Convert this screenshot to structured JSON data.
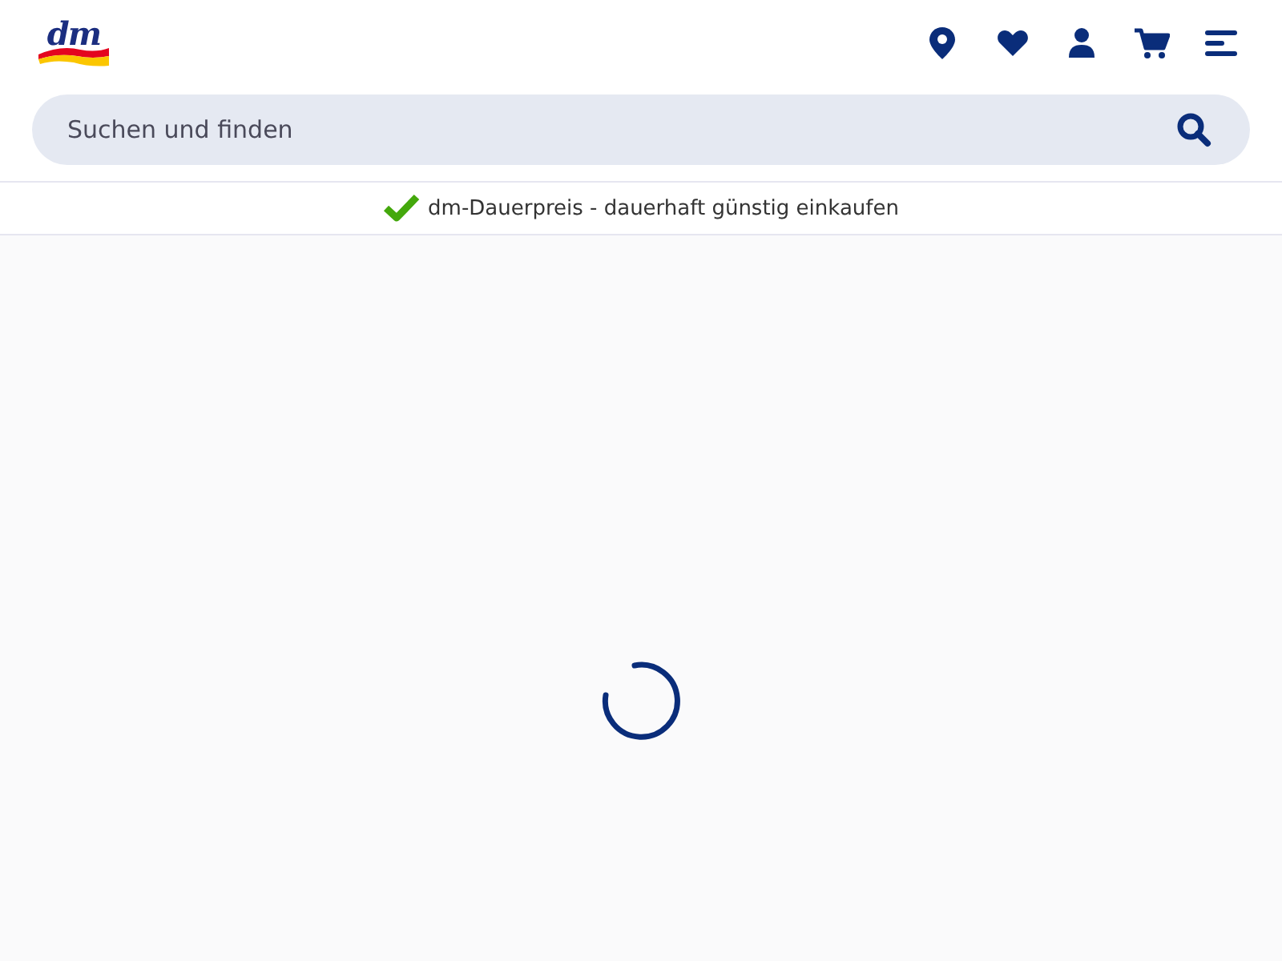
{
  "logo": {
    "text": "dm"
  },
  "header_icons": [
    {
      "kind": "location"
    },
    {
      "kind": "heart"
    },
    {
      "kind": "account"
    },
    {
      "kind": "cart"
    },
    {
      "kind": "menu"
    }
  ],
  "search": {
    "placeholder": "Suchen und finden"
  },
  "banner": {
    "text": "dm-Dauerpreis - dauerhaft günstig einkaufen"
  },
  "content": {
    "loading": true
  }
}
